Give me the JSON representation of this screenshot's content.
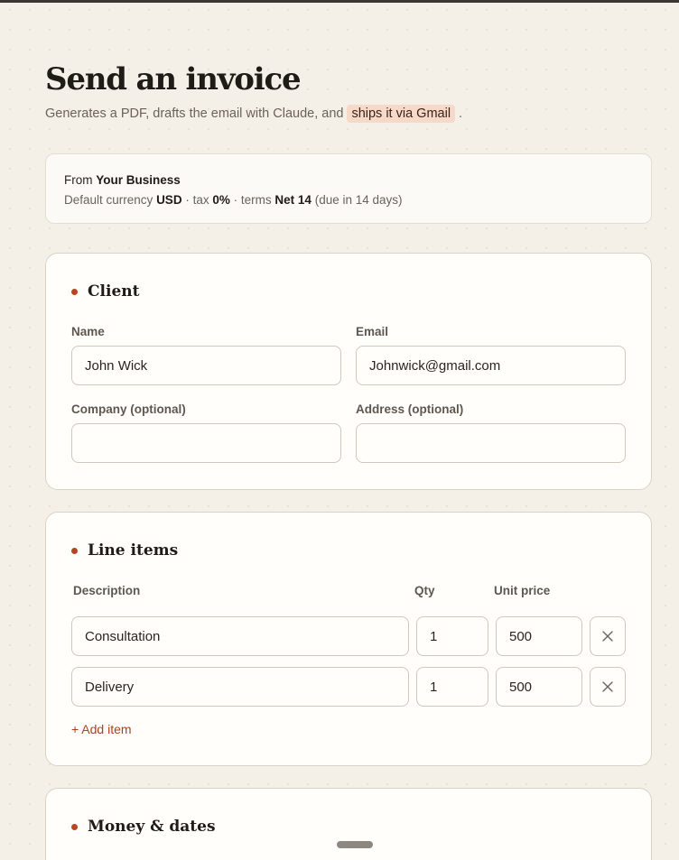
{
  "header": {
    "title": "Send an invoice",
    "subtitle_pre": "Generates a PDF, drafts the email with Claude, and",
    "subtitle_highlight": "ships it via Gmail",
    "subtitle_post": "."
  },
  "from_box": {
    "from_prefix": "From",
    "business_name": "Your Business",
    "currency_prefix": "Default currency",
    "currency": "USD",
    "tax_prefix": "· tax",
    "tax": "0%",
    "terms_prefix": "· terms",
    "terms": "Net 14",
    "terms_suffix": "(due in 14 days)"
  },
  "client": {
    "title": "Client",
    "name_label": "Name",
    "name_value": "John Wick",
    "email_label": "Email",
    "email_value": "Johnwick@gmail.com",
    "company_label": "Company (optional)",
    "company_value": "",
    "address_label": "Address (optional)",
    "address_value": ""
  },
  "line_items": {
    "title": "Line items",
    "col_description": "Description",
    "col_qty": "Qty",
    "col_unit_price": "Unit price",
    "items": [
      {
        "description": "Consultation",
        "qty": "1",
        "unit_price": "500"
      },
      {
        "description": "Delivery",
        "qty": "1",
        "unit_price": "500"
      }
    ],
    "add_item": "+ Add item",
    "remove_icon": "close-icon"
  },
  "money": {
    "title": "Money & dates"
  },
  "colors": {
    "accent": "#b5461f",
    "highlight_bg": "#f6d9c9",
    "page_bg": "#f4f0e7"
  }
}
